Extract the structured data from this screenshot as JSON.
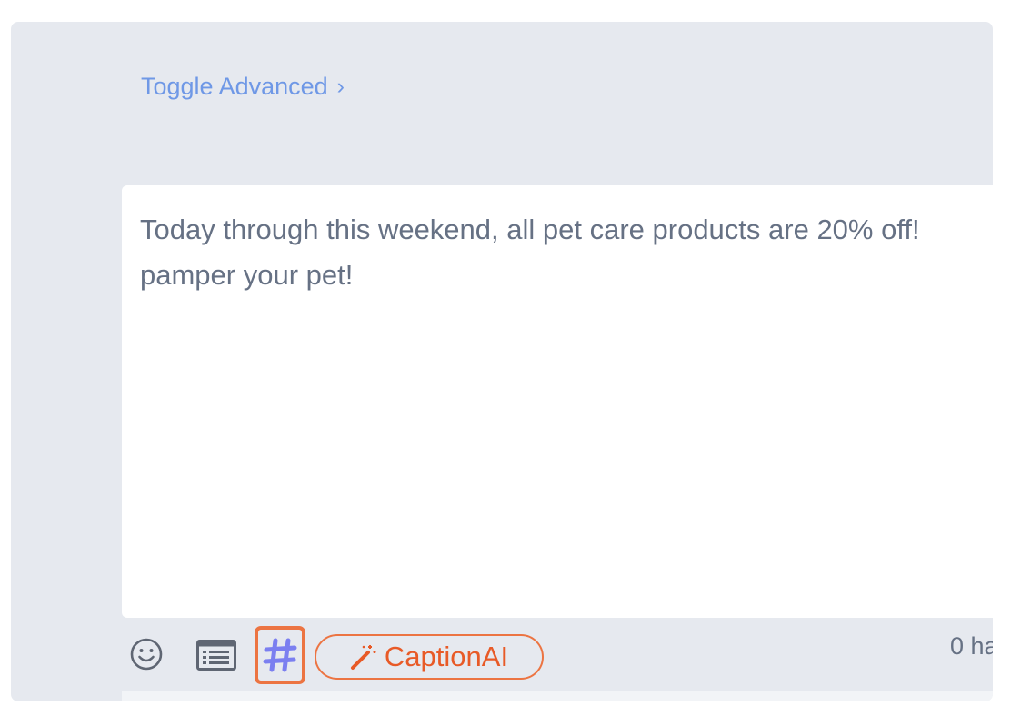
{
  "header": {
    "toggle_label": "Toggle Advanced",
    "toggle_chevron": "›"
  },
  "editor": {
    "text": "Today through this weekend, all pet care products are 20% off!\npamper your pet!"
  },
  "toolbar": {
    "emoji_icon": "emoji-icon",
    "template_icon": "template-list-icon",
    "hashtag_icon": "hashtag-icon",
    "caption_ai_label": "CaptionAI",
    "caption_ai_icon": "magic-wand-icon",
    "hashtag_count": "0 ha"
  },
  "colors": {
    "panel_bg": "#e6e9ef",
    "link": "#6f98e6",
    "accent": "#ec7442",
    "caption_text": "#e85a27",
    "hashtag_icon": "#7b7ff0",
    "body_text": "#667184"
  }
}
